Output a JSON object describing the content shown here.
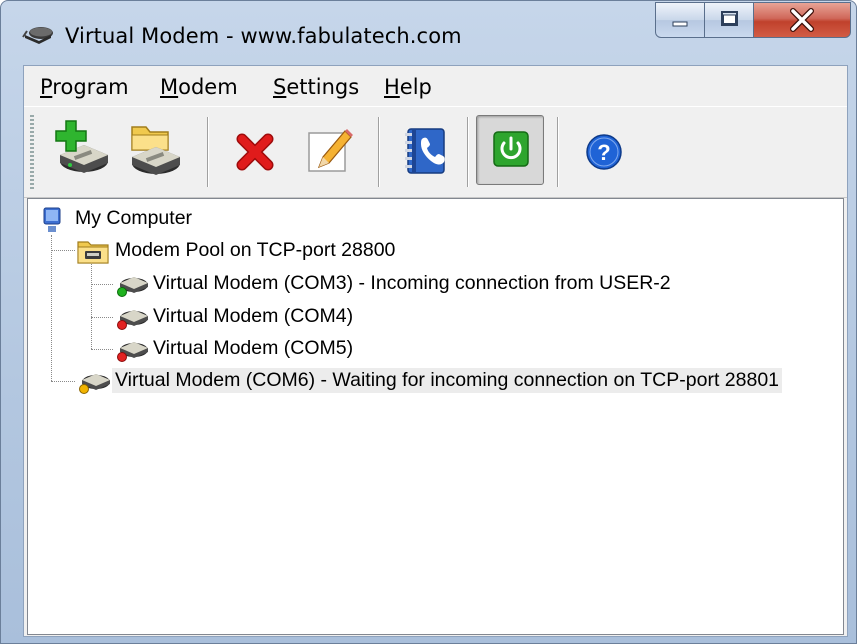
{
  "window": {
    "title": "Virtual Modem - www.fabulatech.com",
    "controls": {
      "minimize": "minimize",
      "maximize": "maximize",
      "close": "close"
    }
  },
  "menu": [
    {
      "label": "Program",
      "accel_prefix": "",
      "accel": "P",
      "accel_rest": "rogram"
    },
    {
      "label": "Modem",
      "accel_prefix": "",
      "accel": "M",
      "accel_rest": "odem"
    },
    {
      "label": "Settings",
      "accel_prefix": "",
      "accel": "S",
      "accel_rest": "ettings"
    },
    {
      "label": "Help",
      "accel_prefix": "",
      "accel": "H",
      "accel_rest": "elp"
    }
  ],
  "toolbar": {
    "buttons": [
      {
        "icon": "add-modem-icon",
        "state": "normal"
      },
      {
        "icon": "add-modem-pool-icon",
        "state": "normal"
      },
      {
        "icon": "delete-icon",
        "state": "normal"
      },
      {
        "icon": "edit-pencil-icon",
        "state": "normal"
      },
      {
        "icon": "phonebook-icon",
        "state": "normal"
      },
      {
        "icon": "power-icon",
        "state": "pressed"
      },
      {
        "icon": "help-icon",
        "state": "normal"
      }
    ],
    "colors": {
      "add": "#2fb52f",
      "delete": "#e01b1b",
      "power": "#2ea52e",
      "help": "#1f63d6"
    }
  },
  "tree": {
    "root": {
      "label": "My Computer",
      "icon": "computer-icon"
    },
    "pool": {
      "label": "Modem Pool on TCP-port 28800",
      "icon": "folder-modem-icon"
    },
    "pool_modems": [
      {
        "label": "Virtual Modem (COM3) - Incoming connection from USER-2",
        "status": "green"
      },
      {
        "label": "Virtual Modem (COM4)",
        "status": "red"
      },
      {
        "label": "Virtual Modem (COM5)",
        "status": "red"
      }
    ],
    "standalone": {
      "label": "Virtual Modem (COM6) - Waiting for incoming connection on TCP-port 28801",
      "status": "yellow",
      "selected": true
    },
    "status_colors": {
      "green": "#1fb21f",
      "red": "#e22222",
      "yellow": "#f2b400"
    }
  }
}
